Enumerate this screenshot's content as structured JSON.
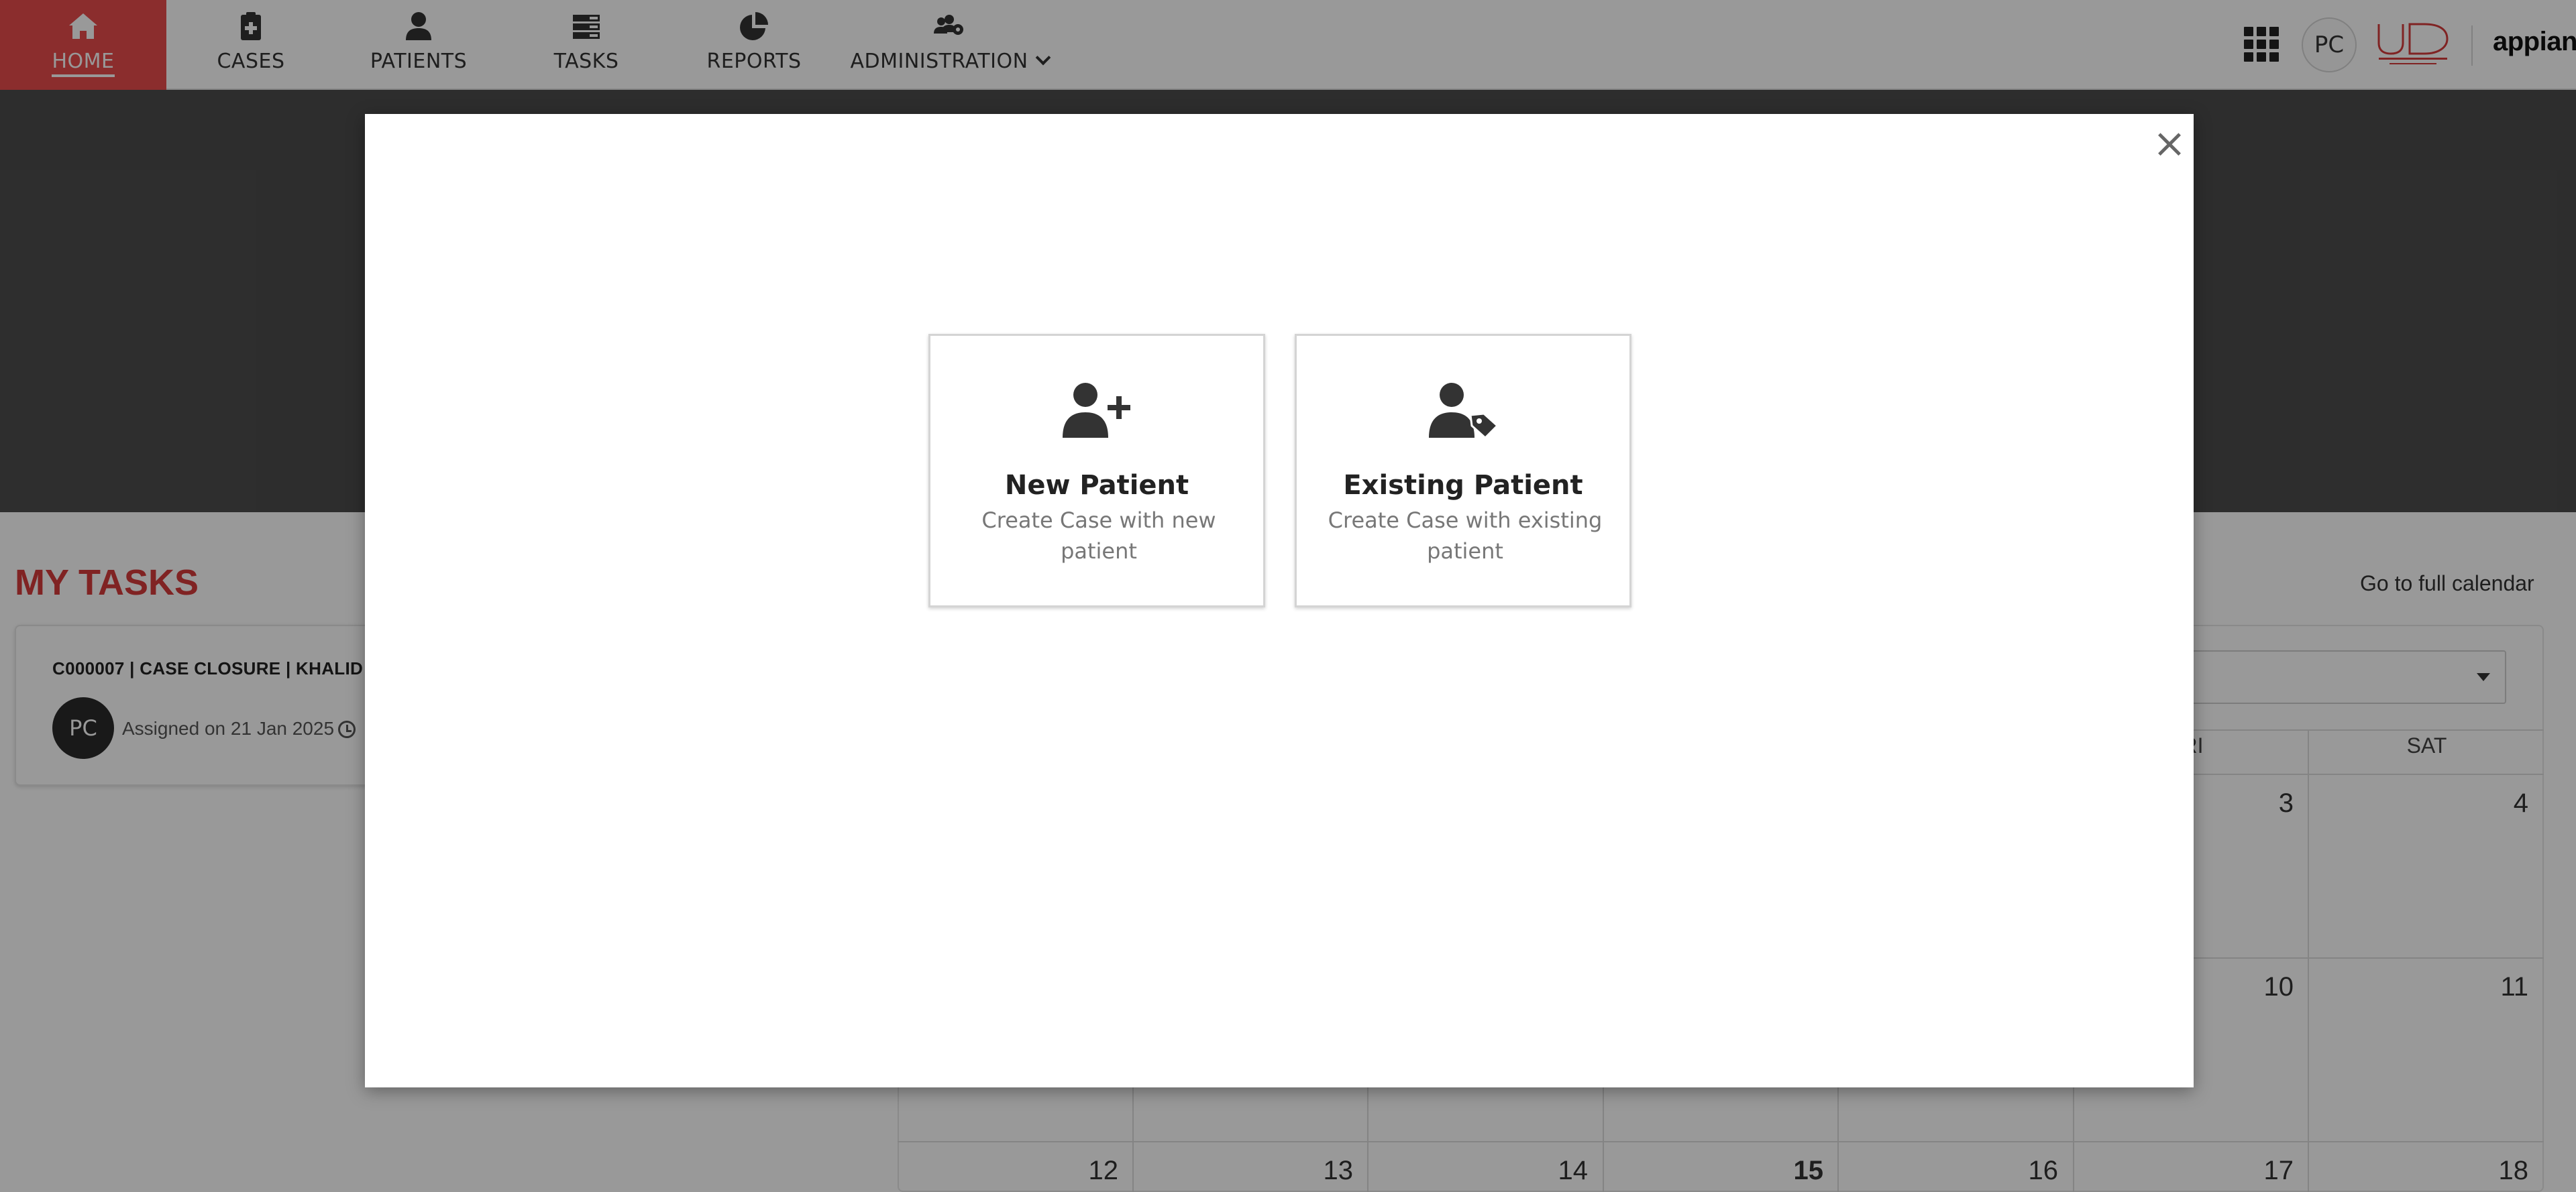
{
  "nav": {
    "items": [
      {
        "label": "HOME",
        "icon": "home-icon",
        "active": true
      },
      {
        "label": "CASES",
        "icon": "clipboard-medical-icon"
      },
      {
        "label": "PATIENTS",
        "icon": "user-icon"
      },
      {
        "label": "TASKS",
        "icon": "tasks-list-icon"
      },
      {
        "label": "REPORTS",
        "icon": "pie-chart-icon"
      },
      {
        "label": "ADMINISTRATION",
        "icon": "users-cog-icon",
        "has_dropdown": true
      }
    ],
    "user_initials": "PC",
    "appian_label": "appian",
    "active_color": "#e84c4c"
  },
  "tasks": {
    "title": "MY TASKS",
    "card": {
      "title": "C000007 | CASE CLOSURE | KHALID",
      "avatar": "PC",
      "assigned": "Assigned on 21 Jan 2025"
    }
  },
  "calendar": {
    "full_link": "Go to full calendar",
    "headers": [
      "RI",
      "SAT"
    ],
    "rows": [
      [
        "",
        "",
        "",
        "",
        "",
        "3",
        "4"
      ],
      [
        "",
        "",
        "",
        "",
        "",
        "10",
        "11"
      ],
      [
        "12",
        "13",
        "14",
        "15",
        "16",
        "17",
        "18"
      ]
    ],
    "today": "15"
  },
  "modal": {
    "close_label": "×",
    "cards": [
      {
        "title": "New Patient",
        "subtitle": "Create Case with new patient",
        "icon": "user-plus-icon"
      },
      {
        "title": "Existing Patient",
        "subtitle": "Create Case with existing patient",
        "icon": "user-tag-icon"
      }
    ]
  }
}
